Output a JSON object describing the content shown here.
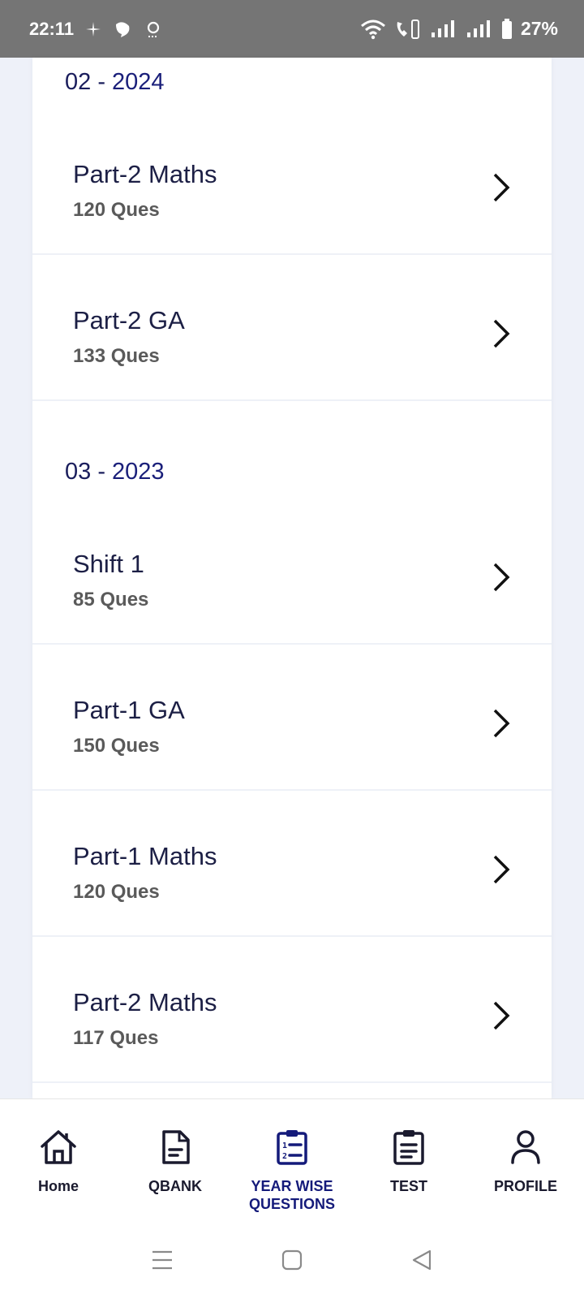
{
  "status_bar": {
    "time": "22:11",
    "battery": "27%",
    "icons": [
      "bluetooth-like-icon",
      "notification-icon",
      "alarm-icon",
      "wifi-icon",
      "volte-icon",
      "signal-icon",
      "signal-icon",
      "battery-icon"
    ]
  },
  "sections": [
    {
      "label_prefix": "02 - ",
      "label_year": "2024",
      "items": [
        {
          "title": "Part-2 Maths",
          "count": "120 Ques"
        },
        {
          "title": "Part-2 GA",
          "count": "133 Ques"
        }
      ]
    },
    {
      "label_prefix": "03 - ",
      "label_year": "2023",
      "items": [
        {
          "title": "Shift 1",
          "count": "85 Ques"
        },
        {
          "title": "Part-1 GA",
          "count": "150 Ques"
        },
        {
          "title": "Part-1 Maths",
          "count": "120 Ques"
        },
        {
          "title": "Part-2 Maths",
          "count": "117 Ques"
        }
      ]
    }
  ],
  "bottom_nav": [
    {
      "label": "Home",
      "icon": "home-icon"
    },
    {
      "label": "QBANK",
      "icon": "document-icon"
    },
    {
      "label": "YEAR WISE QUESTIONS",
      "icon": "clipboard-list-icon",
      "active": true
    },
    {
      "label": "TEST",
      "icon": "clipboard-icon"
    },
    {
      "label": "PROFILE",
      "icon": "user-icon"
    }
  ],
  "colors": {
    "accent": "#1a1f7a",
    "status_bar": "#757575",
    "background": "#eef1f9"
  }
}
